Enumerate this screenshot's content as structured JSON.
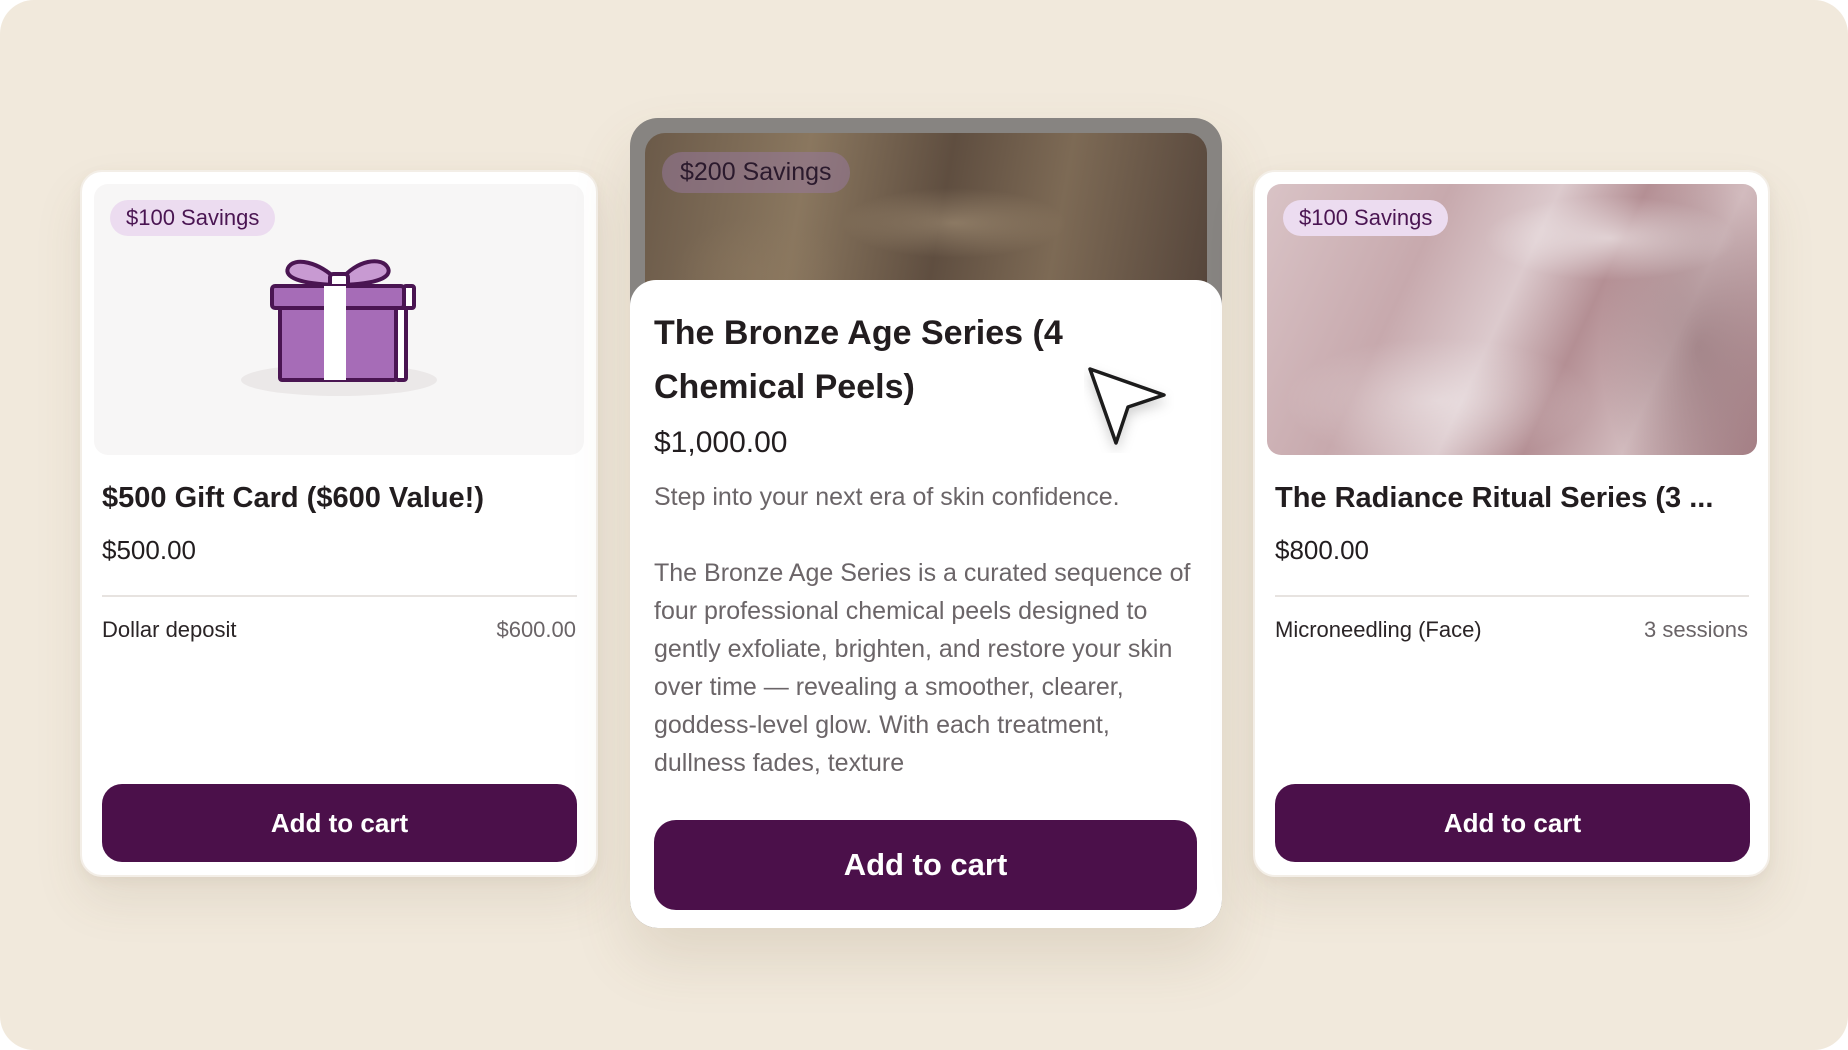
{
  "cards": {
    "left": {
      "badge": "$100 Savings",
      "title": "$500 Gift Card ($600 Value!)",
      "price": "$500.00",
      "detail_label": "Dollar deposit",
      "detail_value": "$600.00",
      "button_label": "Add to cart",
      "image_icon": "gift-box-icon"
    },
    "center": {
      "badge": "$200 Savings",
      "title": "The Bronze Age Series (4 Chemical Peels)",
      "price": "$1,000.00",
      "tagline": "Step into your next era of skin confidence.",
      "description": "The Bronze Age Series is a curated sequence of four professional chemical peels designed to gently exfoliate, brighten, and restore your skin over time — revealing a smoother, clearer, goddess-level glow. With each treatment, dullness fades, texture",
      "button_label": "Add to cart"
    },
    "right": {
      "badge": "$100 Savings",
      "title": "The Radiance Ritual Series (3 ...",
      "price": "$800.00",
      "detail_label": "Microneedling (Face)",
      "detail_value": "3 sessions",
      "button_label": "Add to cart"
    }
  },
  "colors": {
    "background": "#f1e9dc",
    "button": "#4b104a",
    "badge": "#ecdcf0",
    "gift_purple": "#a66cb7"
  },
  "cursor_icon": "mouse-pointer-icon"
}
